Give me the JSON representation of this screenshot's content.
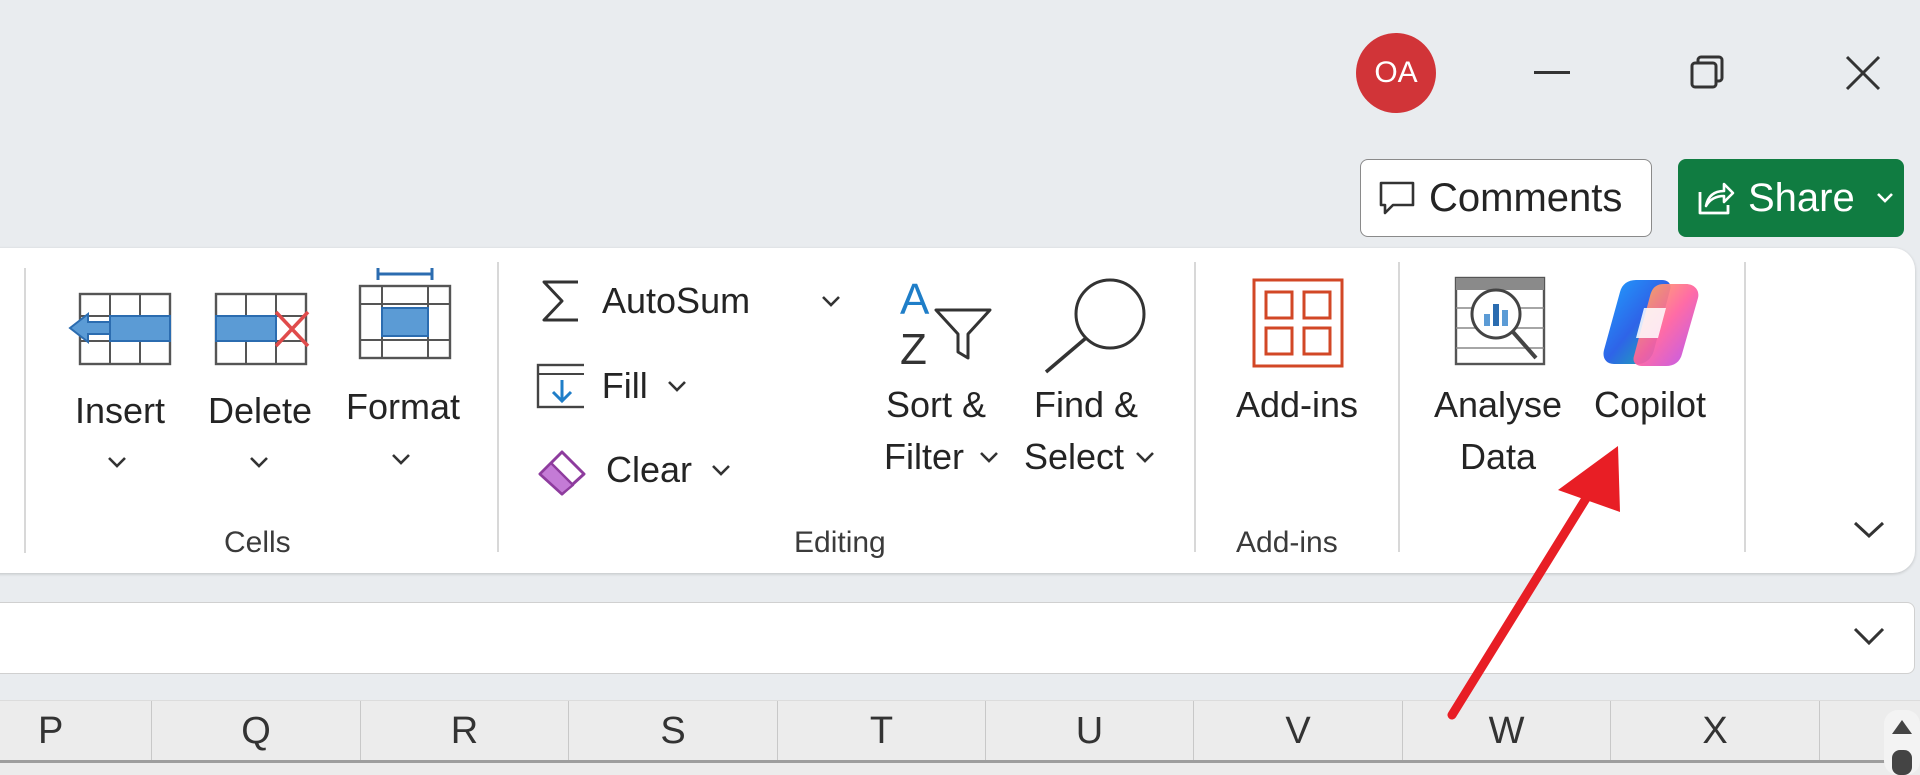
{
  "titlebar": {
    "avatar_initials": "OA",
    "avatar_color": "#d13438"
  },
  "actions": {
    "comments_label": "Comments",
    "share_label": "Share",
    "share_color": "#107c41"
  },
  "ribbon": {
    "cells": {
      "group_label": "Cells",
      "insert_label": "Insert",
      "delete_label": "Delete",
      "format_label": "Format"
    },
    "editing": {
      "group_label": "Editing",
      "autosum_label": "AutoSum",
      "fill_label": "Fill",
      "clear_label": "Clear",
      "sort_line1": "Sort &",
      "sort_line2": "Filter",
      "find_line1": "Find &",
      "find_line2": "Select"
    },
    "addins": {
      "group_label": "Add-ins",
      "addins_label": "Add-ins"
    },
    "analysis": {
      "analyse_line1": "Analyse",
      "analyse_line2": "Data",
      "copilot_label": "Copilot"
    }
  },
  "columns": [
    "P",
    "Q",
    "R",
    "S",
    "T",
    "U",
    "V",
    "W",
    "X"
  ],
  "annotation": {
    "arrow_color": "#e81e25"
  }
}
